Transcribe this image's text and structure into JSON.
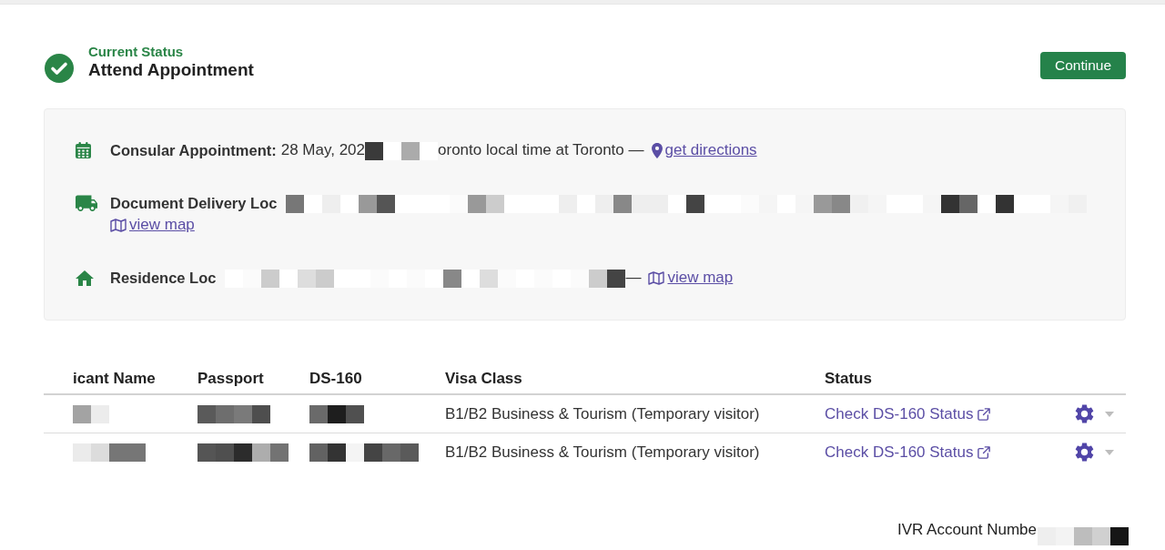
{
  "header": {
    "status_label": "Current Status",
    "status": "Attend Appointment",
    "continue_button": "Continue"
  },
  "details": [
    {
      "kind": "calendar",
      "label": "Consular Appointment:",
      "value": "28 May, 202",
      "redacted": true,
      "suffix": "oronto local time at Toronto —",
      "link": "get directions"
    },
    {
      "kind": "truck",
      "label": "Document Delivery Loc",
      "redacted": true,
      "link": "view map"
    },
    {
      "kind": "home",
      "label": "Residence Loc",
      "redacted": true,
      "suffix": "—",
      "link": "view map"
    }
  ],
  "table": {
    "columns": [
      "icant Name",
      "Passport",
      "DS-160",
      "Visa Class",
      "Status"
    ],
    "rows": [
      {
        "redacted": true,
        "visa_class": "B1/B2 Business & Tourism (Temporary visitor)",
        "status_link": "Check DS-160 Status"
      },
      {
        "redacted": true,
        "visa_class": "B1/B2 Business & Tourism (Temporary visitor)",
        "status_link": "Check DS-160 Status"
      }
    ]
  },
  "footer": {
    "ivr_label": "IVR Account Numbe",
    "redacted": true
  }
}
